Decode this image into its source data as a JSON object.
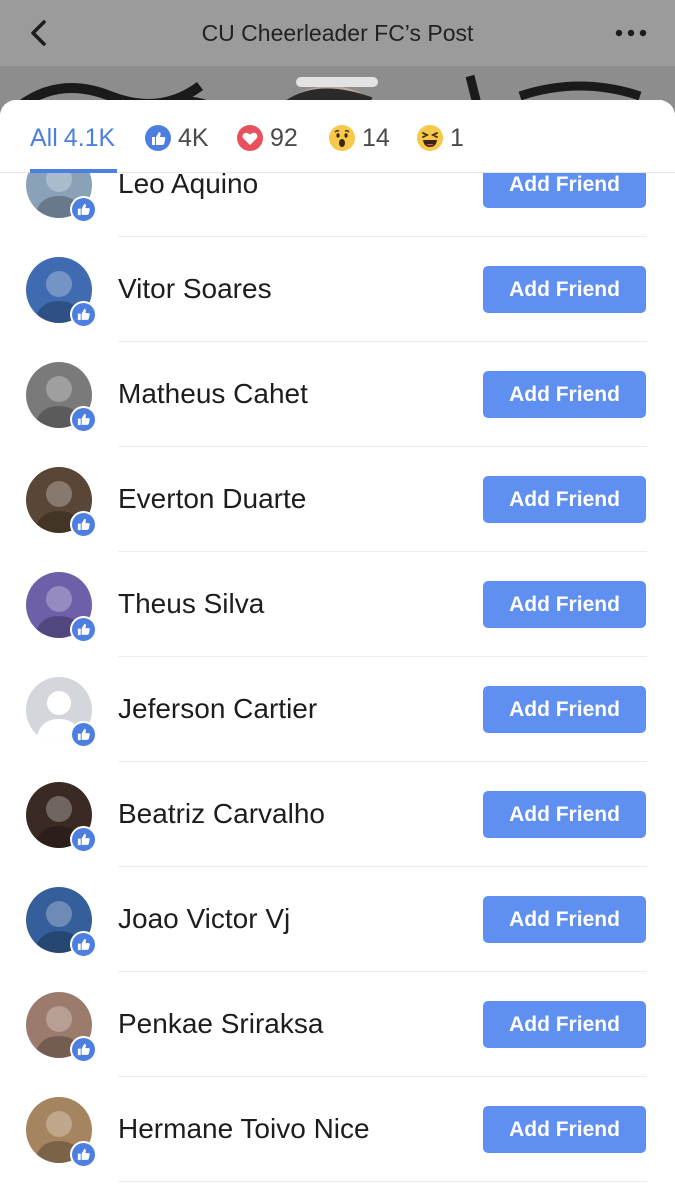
{
  "header": {
    "title": "CU Cheerleader FC’s Post"
  },
  "tabs": [
    {
      "label": "All",
      "count": "4.1K",
      "icon": "all"
    },
    {
      "count": "4K",
      "icon": "like-icon"
    },
    {
      "count": "92",
      "icon": "love-icon"
    },
    {
      "count": "14",
      "icon": "wow-icon"
    },
    {
      "count": "1",
      "icon": "haha-icon"
    }
  ],
  "button_label": "Add Friend",
  "people": [
    {
      "name": "Leo Aquino",
      "avatar": "#8aa2b8"
    },
    {
      "name": "Vitor Soares",
      "avatar": "#3f6bb0"
    },
    {
      "name": "Matheus Cahet",
      "avatar": "#7a7a7a"
    },
    {
      "name": "Everton Duarte",
      "avatar": "#5a4636"
    },
    {
      "name": "Theus Silva",
      "avatar": "#6d5fa8"
    },
    {
      "name": "Jeferson Cartier",
      "avatar": "#cfd2d8"
    },
    {
      "name": "Beatriz Carvalho",
      "avatar": "#3b2a24"
    },
    {
      "name": "Joao Victor Vj",
      "avatar": "#355f9a"
    },
    {
      "name": "Penkae Sriraksa",
      "avatar": "#9b7b6c"
    },
    {
      "name": "Hermane Toivo Nice",
      "avatar": "#a5855f"
    }
  ],
  "colors": {
    "accent": "#4d7fe0",
    "button": "#5f8ff0"
  }
}
